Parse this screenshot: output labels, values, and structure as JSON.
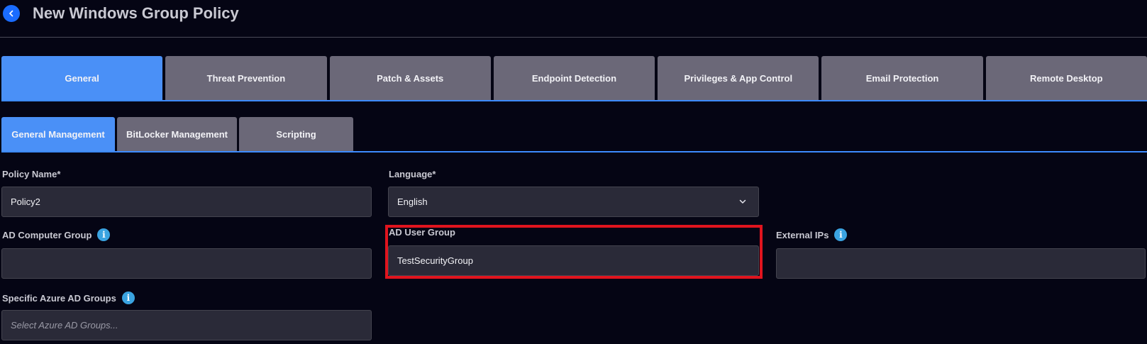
{
  "header": {
    "title": "New Windows Group Policy"
  },
  "main_tabs": [
    {
      "label": "General",
      "active": true
    },
    {
      "label": "Threat Prevention",
      "active": false
    },
    {
      "label": "Patch & Assets",
      "active": false
    },
    {
      "label": "Endpoint Detection",
      "active": false
    },
    {
      "label": "Privileges & App Control",
      "active": false
    },
    {
      "label": "Email Protection",
      "active": false
    },
    {
      "label": "Remote Desktop",
      "active": false
    }
  ],
  "sub_tabs": [
    {
      "label": "General Management",
      "active": true
    },
    {
      "label": "BitLocker Management",
      "active": false
    },
    {
      "label": "Scripting",
      "active": false
    }
  ],
  "form": {
    "policy_name": {
      "label": "Policy Name*",
      "value": "Policy2"
    },
    "language": {
      "label": "Language*",
      "value": "English"
    },
    "ad_computer_group": {
      "label": "AD Computer Group",
      "value": ""
    },
    "ad_user_group": {
      "label": "AD User Group",
      "value": "TestSecurityGroup"
    },
    "external_ips": {
      "label": "External IPs",
      "value": ""
    },
    "azure_ad_groups": {
      "label": "Specific Azure AD Groups",
      "placeholder": "Select Azure AD Groups..."
    }
  },
  "colors": {
    "background": "#050514",
    "active_tab": "#4a90f7",
    "inactive_tab": "#6b6878",
    "accent": "#1a6cff",
    "highlight": "#e0141e",
    "info": "#3aa3e0"
  },
  "icons": {
    "back": "chevron-left-icon",
    "dropdown": "chevron-down-icon",
    "info": "info-icon"
  }
}
